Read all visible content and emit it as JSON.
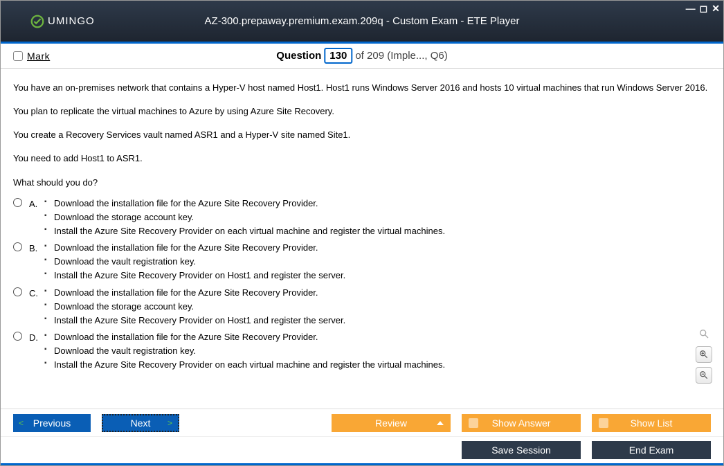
{
  "window": {
    "brand": "UMINGO",
    "title": "AZ-300.prepaway.premium.exam.209q - Custom Exam - ETE Player"
  },
  "header": {
    "mark_label": "Mark",
    "question_label": "Question",
    "question_number": "130",
    "of_text": "of 209 (Imple..., Q6)"
  },
  "content": {
    "para1": "You have an on-premises network that contains a Hyper-V host named Host1. Host1 runs Windows Server 2016 and hosts 10 virtual machines that run Windows Server 2016.",
    "para2": "You plan to replicate the virtual machines to Azure by using Azure Site Recovery.",
    "para3": "You create a Recovery Services vault named ASR1 and a Hyper-V site named Site1.",
    "para4": "You need to add Host1 to ASR1.",
    "para5": "What should you do?"
  },
  "answers": [
    {
      "letter": "A.",
      "lines": [
        "Download the installation file for the Azure Site Recovery Provider.",
        "Download the storage account key.",
        "Install the Azure Site Recovery Provider on each virtual machine and register the virtual machines."
      ]
    },
    {
      "letter": "B.",
      "lines": [
        "Download the installation file for the Azure Site Recovery Provider.",
        "Download the vault registration key.",
        "Install the Azure Site Recovery Provider on Host1 and register the server."
      ]
    },
    {
      "letter": "C.",
      "lines": [
        "Download the installation file for the Azure Site Recovery Provider.",
        "Download the storage account key.",
        "Install the Azure Site Recovery Provider on Host1 and register the server."
      ]
    },
    {
      "letter": "D.",
      "lines": [
        "Download the installation file for the Azure Site Recovery Provider.",
        "Download the vault registration key.",
        "Install the Azure Site Recovery Provider on each virtual machine and register the virtual machines."
      ]
    }
  ],
  "buttons": {
    "previous": "Previous",
    "next": "Next",
    "review": "Review",
    "show_answer": "Show Answer",
    "show_list": "Show List",
    "save_session": "Save Session",
    "end_exam": "End Exam"
  }
}
